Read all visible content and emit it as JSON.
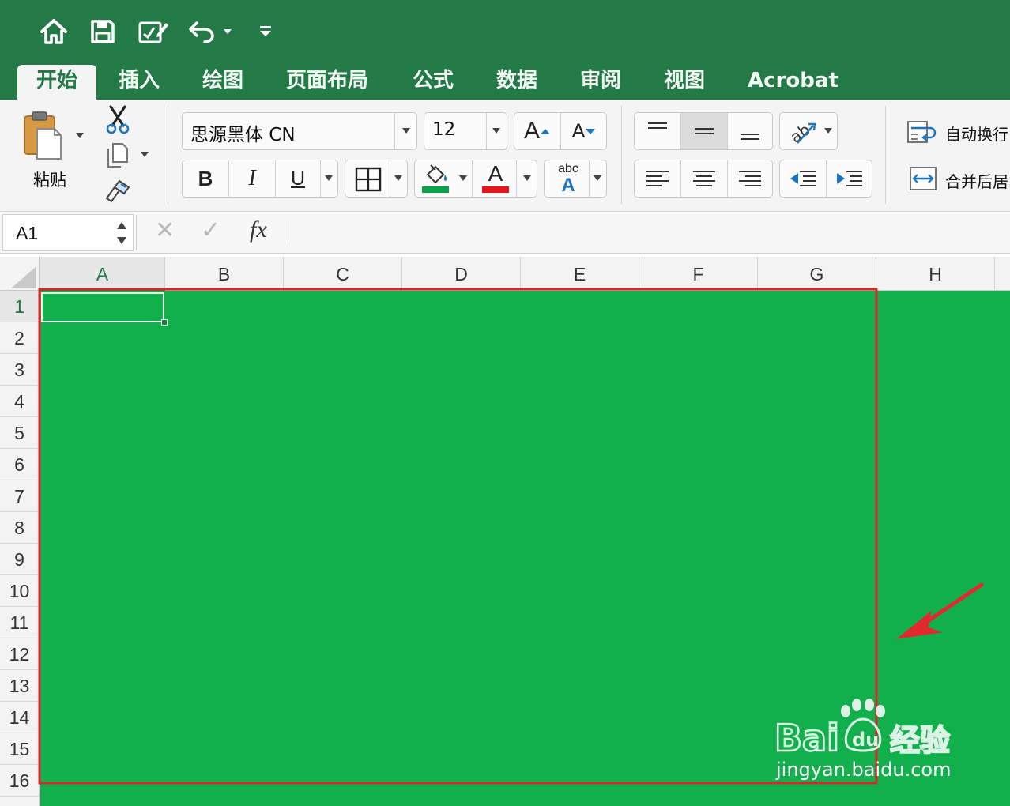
{
  "quick_access": {
    "icons": [
      "home-icon",
      "save-icon",
      "edit-icon",
      "undo-icon",
      "customize-toolbar-icon"
    ]
  },
  "tabs": [
    {
      "label": "开始",
      "active": true
    },
    {
      "label": "插入"
    },
    {
      "label": "绘图"
    },
    {
      "label": "页面布局"
    },
    {
      "label": "公式"
    },
    {
      "label": "数据"
    },
    {
      "label": "审阅"
    },
    {
      "label": "视图"
    },
    {
      "label": "Acrobat"
    }
  ],
  "ribbon": {
    "paste_label": "粘贴",
    "font_name": "思源黑体 CN",
    "font_size": "12",
    "bold_label": "B",
    "italic_label": "I",
    "underline_label": "U",
    "grow_font_label": "A",
    "shrink_font_label": "A",
    "font_color_label": "A",
    "fill_color": "#0ca24a",
    "font_color": "#e8141c",
    "phonetic_small": "abc",
    "phonetic_big": "A",
    "wrap_text_label": "自动换行",
    "merge_center_label": "合并后居"
  },
  "formula_bar": {
    "name_box": "A1",
    "cancel_symbol": "✕",
    "enter_symbol": "✓",
    "fx_label": "fx"
  },
  "grid": {
    "columns": [
      "A",
      "B",
      "C",
      "D",
      "E",
      "F",
      "G",
      "H"
    ],
    "rows": [
      "1",
      "2",
      "3",
      "4",
      "5",
      "6",
      "7",
      "8",
      "9",
      "10",
      "11",
      "12",
      "13",
      "14",
      "15",
      "16"
    ],
    "selected_cell": "A1",
    "fill_color": "#11b04d"
  },
  "annotation": {
    "box_color": "#d9262d",
    "arrow_color": "#e02a2f"
  },
  "watermark": {
    "brand": "Bai du 经验",
    "url": "jingyan.baidu.com"
  }
}
